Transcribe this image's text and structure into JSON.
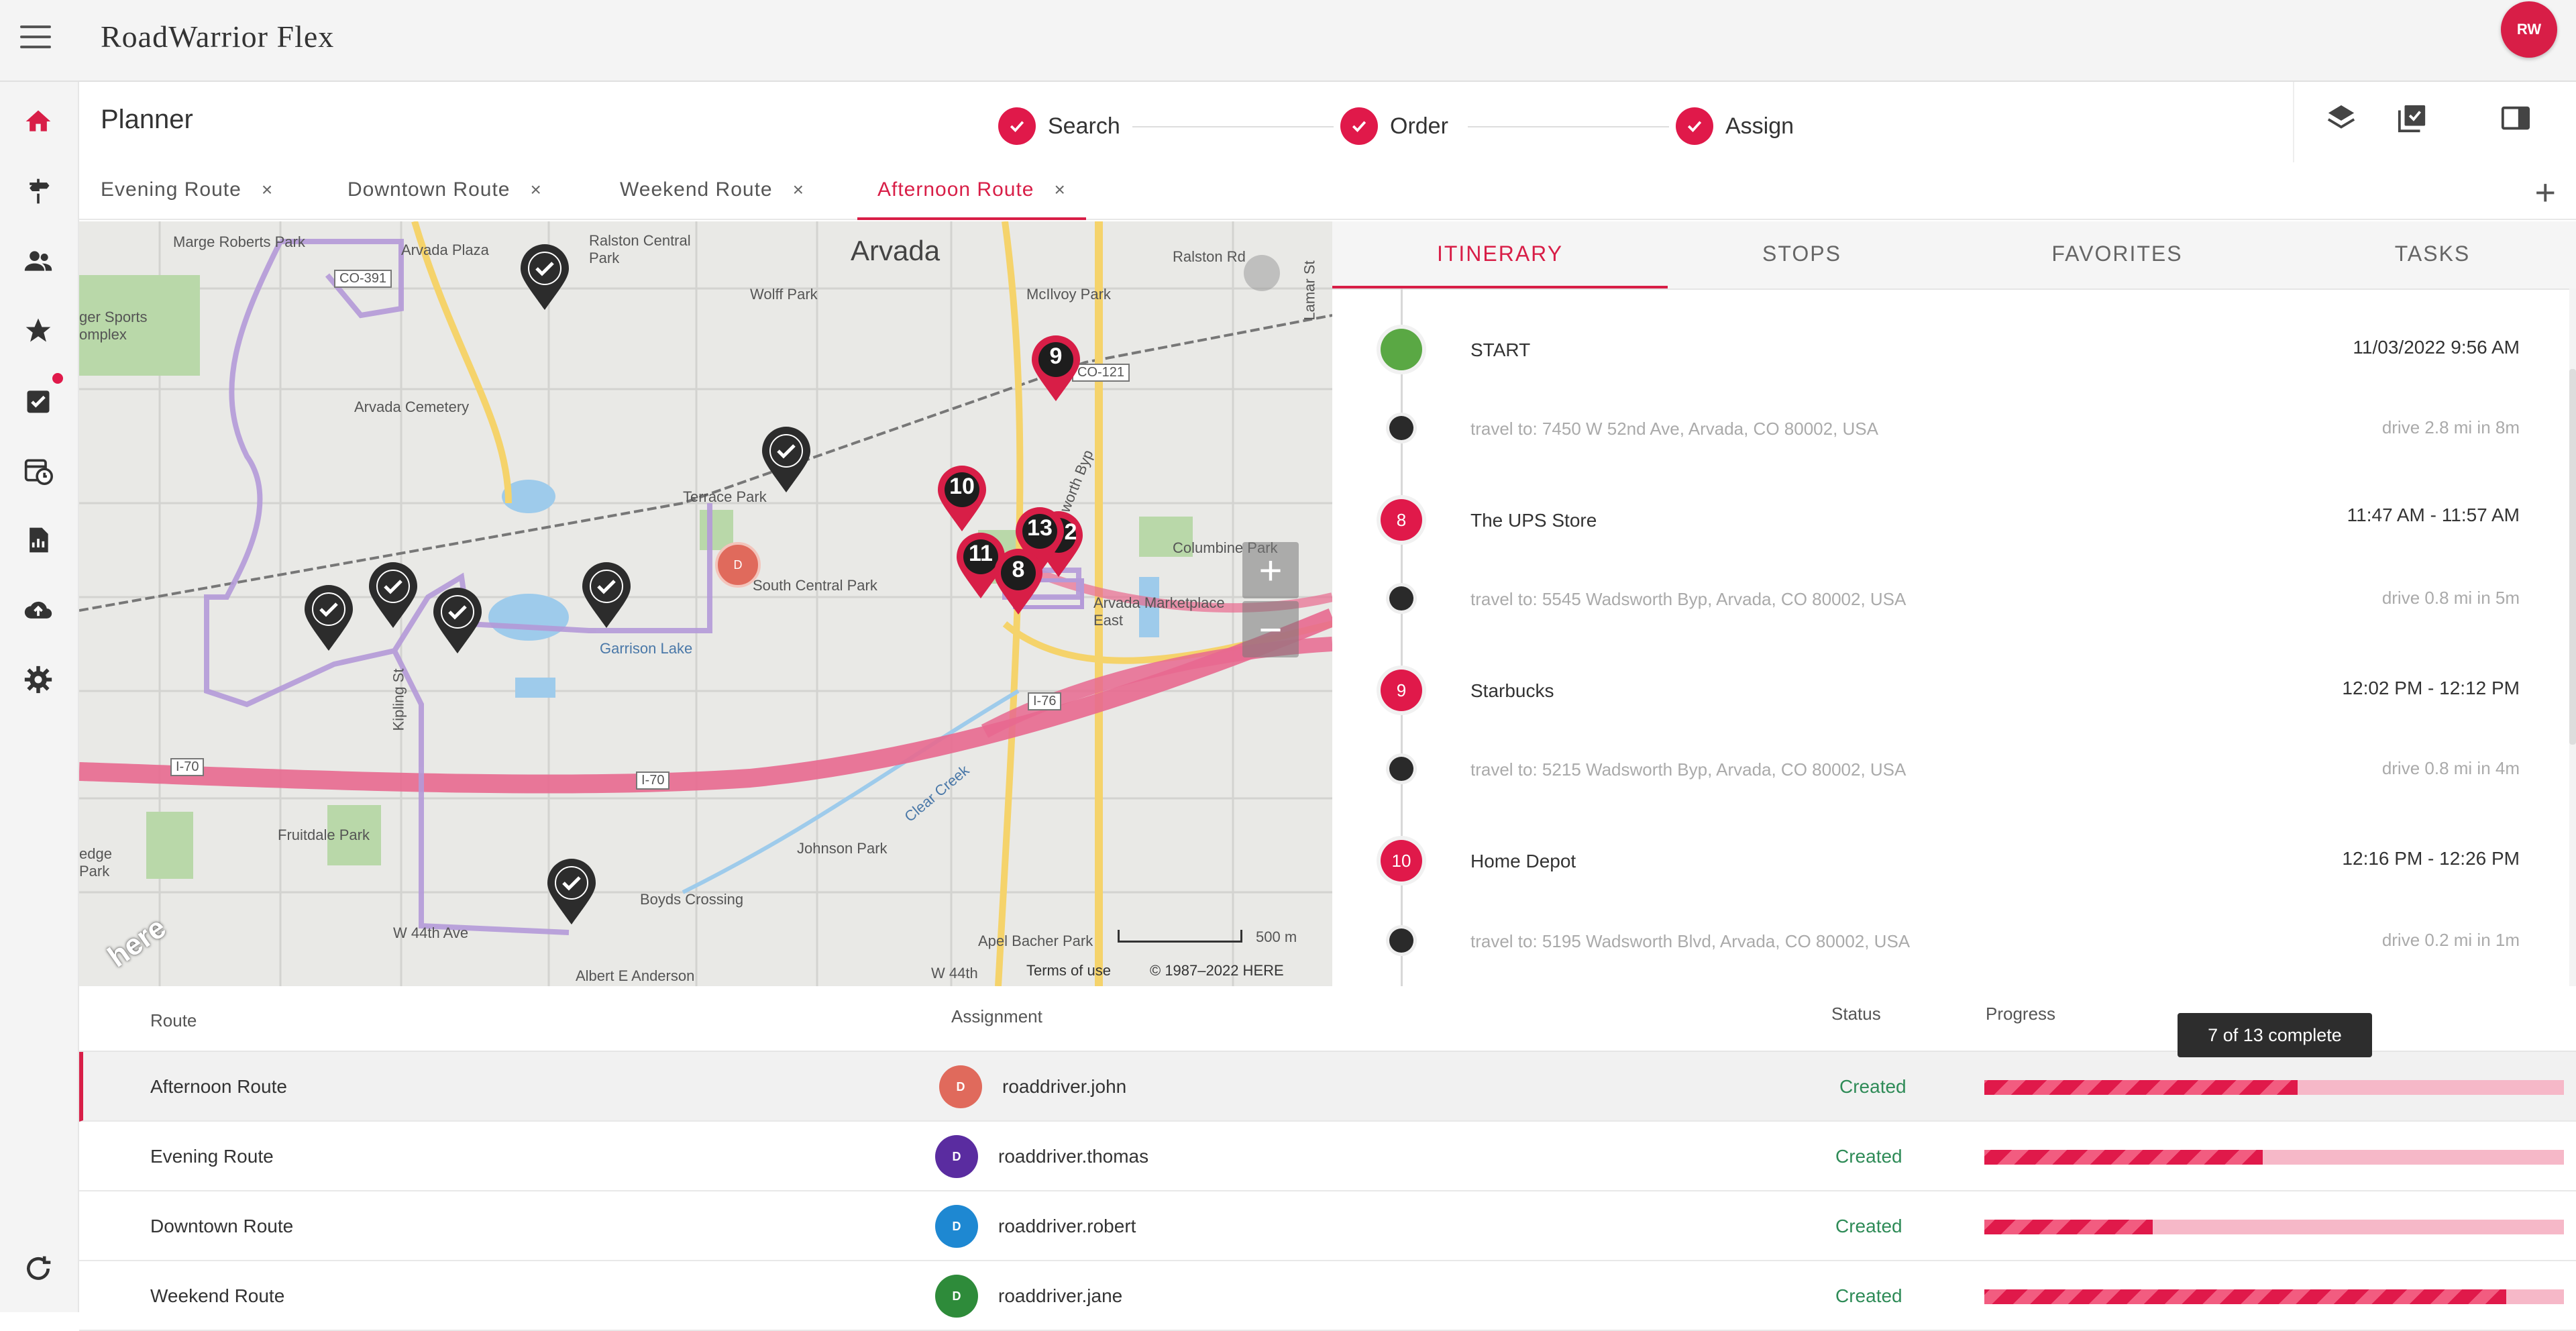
{
  "app": {
    "title": "RoadWarrior Flex",
    "user_initials": "RW"
  },
  "nav": {
    "items": [
      {
        "name": "home-icon"
      },
      {
        "name": "routes-icon"
      },
      {
        "name": "people-icon"
      },
      {
        "name": "star-icon"
      },
      {
        "name": "tasks-icon"
      },
      {
        "name": "calendar-clock-icon"
      },
      {
        "name": "report-icon"
      },
      {
        "name": "cloud-upload-icon"
      },
      {
        "name": "gear-icon"
      },
      {
        "name": "refresh-icon"
      }
    ]
  },
  "planner": {
    "title": "Planner",
    "steps": [
      {
        "label": "Search",
        "done": true
      },
      {
        "label": "Order",
        "done": true
      },
      {
        "label": "Assign",
        "done": true
      }
    ]
  },
  "tabs": [
    {
      "label": "Evening Route",
      "active": false
    },
    {
      "label": "Downtown Route",
      "active": false
    },
    {
      "label": "Weekend Route",
      "active": false
    },
    {
      "label": "Afternoon Route",
      "active": true
    }
  ],
  "tab_close": "×",
  "tab_add": "+",
  "map": {
    "labels": {
      "arvada": "Arvada",
      "marge": "Marge Roberts Park",
      "arvada_plaza": "Arvada Plaza",
      "ralston_central": "Ralston Central Park",
      "wolff": "Wolff Park",
      "mcilvoy": "McIlvoy Park",
      "ralston_rd": "Ralston Rd",
      "lamar": "Lamar St",
      "co391": "CO-391",
      "co121": "CO-121",
      "sports": "ger Sports omplex",
      "cemetery": "Arvada Cemetery",
      "terrace": "Terrace Park",
      "wadsworth": "Wadsworth Byp",
      "columbine": "Columbine Park",
      "south_central": "South Central Park",
      "marketplace": "Arvada Marketplace East",
      "garrison": "Garrison Lake",
      "kipling": "Kipling St",
      "i76": "I-76",
      "i70a": "I-70",
      "i70b": "I-70",
      "clear_creek": "Clear Creek",
      "fruitdale": "Fruitdale Park",
      "johnson": "Johnson Park",
      "edge": "edge Park",
      "boyds": "Boyds Crossing",
      "w44": "W 44th Ave",
      "apel": "Apel Bacher Park",
      "albert": "Albert E Anderson",
      "w44b": "W 44th",
      "terms": "Terms of use",
      "copyright": "© 1987–2022 HERE",
      "scale": "500 m",
      "here_logo": "here",
      "depot": "D"
    },
    "numbered_pins": [
      "9",
      "10",
      "11",
      "13",
      "2",
      "8"
    ],
    "zoom_in": "+",
    "zoom_out": "−"
  },
  "itinerary": {
    "tabs": [
      "ITINERARY",
      "STOPS",
      "FAVORITES",
      "TASKS"
    ],
    "active_tab": "ITINERARY",
    "stops": [
      {
        "marker": "",
        "name": "START",
        "time": "11/03/2022 9:56 AM",
        "color": "#5aa844",
        "travel": "travel to: 7450 W 52nd Ave, Arvada, CO 80002, USA",
        "drive": "drive 2.8 mi in 8m"
      },
      {
        "marker": "8",
        "name": "The UPS Store",
        "time": "11:47 AM - 11:57 AM",
        "color": "#e0194a",
        "travel": "travel to: 5545 Wadsworth Byp, Arvada, CO 80002, USA",
        "drive": "drive 0.8 mi in 5m"
      },
      {
        "marker": "9",
        "name": "Starbucks",
        "time": "12:02 PM - 12:12 PM",
        "color": "#e0194a",
        "travel": "travel to: 5215 Wadsworth Byp, Arvada, CO 80002, USA",
        "drive": "drive 0.8 mi in 4m"
      },
      {
        "marker": "10",
        "name": "Home Depot",
        "time": "12:16 PM - 12:26 PM",
        "color": "#e0194a",
        "travel": "travel to: 5195 Wadsworth Blvd, Arvada, CO 80002, USA",
        "drive": "drive 0.2 mi in 1m"
      }
    ]
  },
  "table": {
    "headers": {
      "route": "Route",
      "assignment": "Assignment",
      "status": "Status",
      "progress": "Progress"
    },
    "rows": [
      {
        "route": "Afternoon Route",
        "avatar": "D",
        "avatar_color": "#e06a5c",
        "driver": "roaddriver.john",
        "status": "Created",
        "progress": 0.54,
        "selected": true
      },
      {
        "route": "Evening Route",
        "avatar": "D",
        "avatar_color": "#5a2ca0",
        "driver": "roaddriver.thomas",
        "status": "Created",
        "progress": 0.48,
        "selected": false
      },
      {
        "route": "Downtown Route",
        "avatar": "D",
        "avatar_color": "#1e88d2",
        "driver": "roaddriver.robert",
        "status": "Created",
        "progress": 0.29,
        "selected": false
      },
      {
        "route": "Weekend Route",
        "avatar": "D",
        "avatar_color": "#2e8b3a",
        "driver": "roaddriver.jane",
        "status": "Created",
        "progress": 0.9,
        "selected": false
      }
    ],
    "tooltip": "7 of 13 complete"
  }
}
